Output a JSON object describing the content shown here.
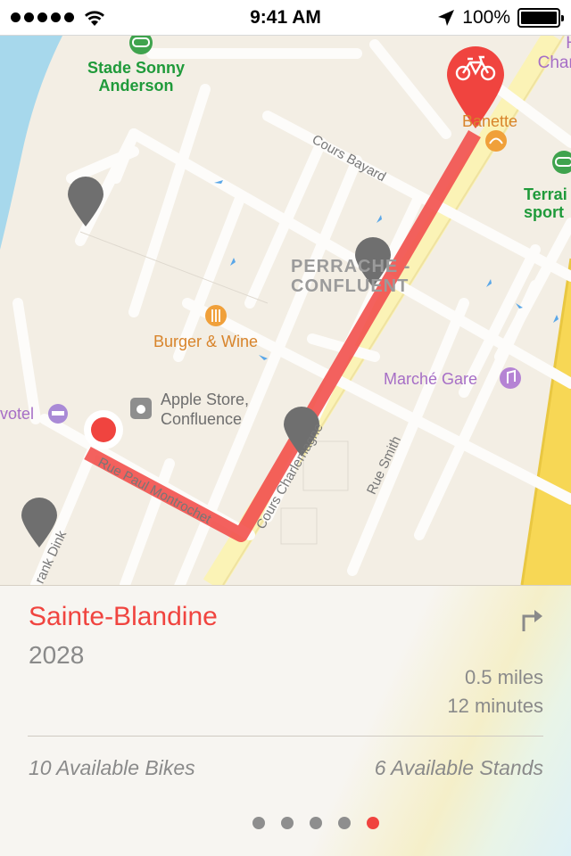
{
  "status_bar": {
    "time": "9:41 AM",
    "battery": "100%",
    "icons": [
      "signal-dots",
      "wifi-icon",
      "location-arrow-icon",
      "battery-icon"
    ]
  },
  "map": {
    "labels": {
      "stadium": "Stade Sonny\nAnderson",
      "charl_partial": "H\nCharl",
      "bakery": "Banette",
      "terrain_partial": "Terrai\nsport",
      "street_bayard": "Cours Bayard",
      "district": "PERRACHE -\nCONFLUENT",
      "restaurant": "Burger & Wine",
      "market": "Marché Gare",
      "hotel_partial": "votel",
      "apple_store": "Apple Store,\nConfluence",
      "street_montrochet": "Rue Paul Montrochet",
      "street_charlemagne": "Cours Charlemagne",
      "street_smith": "Rue Smith",
      "street_frank": "rank Dink"
    },
    "colors": {
      "route": "#f25450",
      "origin": "#f0443f",
      "pin_gray": "#6f6f6f",
      "water": "#a7d8ec",
      "highway": "#f7d755"
    }
  },
  "station": {
    "name": "Sainte-Blandine",
    "id": "2028",
    "distance": "0.5 miles",
    "duration": "12 minutes",
    "bikes": "10 Available Bikes",
    "stands": "6 Available Stands"
  },
  "pager": {
    "count": 5,
    "active_index": 4
  }
}
